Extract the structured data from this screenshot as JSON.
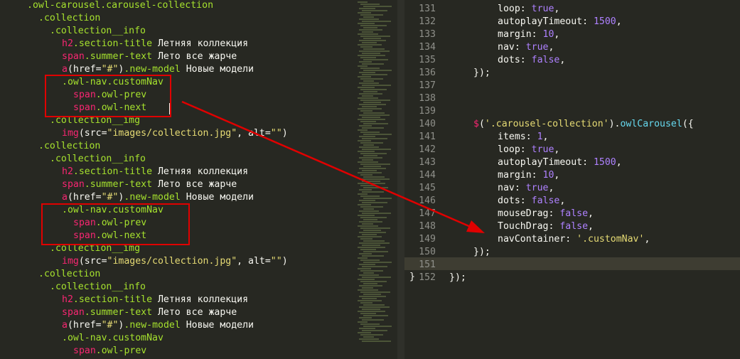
{
  "left_code": [
    [
      {
        "t": ".owl-carousel.carousel-collection",
        "c": "sel"
      }
    ],
    [
      {
        "t": ".collection",
        "c": "sel"
      }
    ],
    [
      {
        "t": ".collection__info",
        "c": "sel"
      }
    ],
    [
      {
        "t": "h2",
        "c": "tag"
      },
      {
        "t": ".section-title",
        "c": "sel"
      },
      {
        "t": " Летняя коллекция",
        "c": "txt"
      }
    ],
    [
      {
        "t": "span",
        "c": "tag"
      },
      {
        "t": ".summer-text",
        "c": "sel"
      },
      {
        "t": " Лето все жарче",
        "c": "txt"
      }
    ],
    [
      {
        "t": "a",
        "c": "tag"
      },
      {
        "t": "(href=",
        "c": "pun"
      },
      {
        "t": "\"#\"",
        "c": "str"
      },
      {
        "t": ")",
        "c": "pun"
      },
      {
        "t": ".new-model",
        "c": "sel"
      },
      {
        "t": " Новые модели",
        "c": "txt"
      }
    ],
    [
      {
        "t": ".owl-nav.customNav",
        "c": "sel"
      }
    ],
    [
      {
        "t": "span",
        "c": "tag"
      },
      {
        "t": ".owl-prev",
        "c": "sel"
      }
    ],
    [
      {
        "t": "span",
        "c": "tag"
      },
      {
        "t": ".owl-next",
        "c": "sel"
      }
    ],
    [
      {
        "t": ".collection__img",
        "c": "sel"
      }
    ],
    [
      {
        "t": "img",
        "c": "tag"
      },
      {
        "t": "(src=",
        "c": "pun"
      },
      {
        "t": "\"images/collection.jpg\"",
        "c": "str"
      },
      {
        "t": ", alt=",
        "c": "pun"
      },
      {
        "t": "\"\"",
        "c": "str"
      },
      {
        "t": ")",
        "c": "pun"
      }
    ],
    [
      {
        "t": ".collection",
        "c": "sel"
      }
    ],
    [
      {
        "t": ".collection__info",
        "c": "sel"
      }
    ],
    [
      {
        "t": "h2",
        "c": "tag"
      },
      {
        "t": ".section-title",
        "c": "sel"
      },
      {
        "t": " Летняя коллекция",
        "c": "txt"
      }
    ],
    [
      {
        "t": "span",
        "c": "tag"
      },
      {
        "t": ".summer-text",
        "c": "sel"
      },
      {
        "t": " Лето все жарче",
        "c": "txt"
      }
    ],
    [
      {
        "t": "a",
        "c": "tag"
      },
      {
        "t": "(href=",
        "c": "pun"
      },
      {
        "t": "\"#\"",
        "c": "str"
      },
      {
        "t": ")",
        "c": "pun"
      },
      {
        "t": ".new-model",
        "c": "sel"
      },
      {
        "t": " Новые модели",
        "c": "txt"
      }
    ],
    [
      {
        "t": ".owl-nav.customNav",
        "c": "sel"
      }
    ],
    [
      {
        "t": "span",
        "c": "tag"
      },
      {
        "t": ".owl-prev",
        "c": "sel"
      }
    ],
    [
      {
        "t": "span",
        "c": "tag"
      },
      {
        "t": ".owl-next",
        "c": "sel"
      }
    ],
    [
      {
        "t": ".collection__img",
        "c": "sel"
      }
    ],
    [
      {
        "t": "img",
        "c": "tag"
      },
      {
        "t": "(src=",
        "c": "pun"
      },
      {
        "t": "\"images/collection.jpg\"",
        "c": "str"
      },
      {
        "t": ", alt=",
        "c": "pun"
      },
      {
        "t": "\"\"",
        "c": "str"
      },
      {
        "t": ")",
        "c": "pun"
      }
    ],
    [
      {
        "t": ".collection",
        "c": "sel"
      }
    ],
    [
      {
        "t": ".collection__info",
        "c": "sel"
      }
    ],
    [
      {
        "t": "h2",
        "c": "tag"
      },
      {
        "t": ".section-title",
        "c": "sel"
      },
      {
        "t": " Летняя коллекция",
        "c": "txt"
      }
    ],
    [
      {
        "t": "span",
        "c": "tag"
      },
      {
        "t": ".summer-text",
        "c": "sel"
      },
      {
        "t": " Лето все жарче",
        "c": "txt"
      }
    ],
    [
      {
        "t": "a",
        "c": "tag"
      },
      {
        "t": "(href=",
        "c": "pun"
      },
      {
        "t": "\"#\"",
        "c": "str"
      },
      {
        "t": ")",
        "c": "pun"
      },
      {
        "t": ".new-model",
        "c": "sel"
      },
      {
        "t": " Новые модели",
        "c": "txt"
      }
    ],
    [
      {
        "t": ".owl-nav.customNav",
        "c": "sel"
      }
    ],
    [
      {
        "t": "span",
        "c": "tag"
      },
      {
        "t": ".owl-prev",
        "c": "sel"
      }
    ]
  ],
  "right_code": [
    {
      "n": "131",
      "s": [
        {
          "t": "loop: ",
          "c": "txt"
        },
        {
          "t": "true",
          "c": "kw"
        },
        {
          "t": ",",
          "c": "txt"
        }
      ]
    },
    {
      "n": "132",
      "s": [
        {
          "t": "autoplayTimeout: ",
          "c": "txt"
        },
        {
          "t": "1500",
          "c": "kw"
        },
        {
          "t": ",",
          "c": "txt"
        }
      ]
    },
    {
      "n": "133",
      "s": [
        {
          "t": "margin: ",
          "c": "txt"
        },
        {
          "t": "10",
          "c": "kw"
        },
        {
          "t": ",",
          "c": "txt"
        }
      ]
    },
    {
      "n": "134",
      "s": [
        {
          "t": "nav: ",
          "c": "txt"
        },
        {
          "t": "true",
          "c": "kw"
        },
        {
          "t": ",",
          "c": "txt"
        }
      ]
    },
    {
      "n": "135",
      "s": [
        {
          "t": "dots: ",
          "c": "txt"
        },
        {
          "t": "false",
          "c": "kw"
        },
        {
          "t": ",",
          "c": "txt"
        }
      ]
    },
    {
      "n": "136",
      "s": [
        {
          "t": "});",
          "c": "txt"
        }
      ]
    },
    {
      "n": "137",
      "s": []
    },
    {
      "n": "138",
      "s": []
    },
    {
      "n": "139",
      "s": []
    },
    {
      "n": "140",
      "s": [
        {
          "t": "$",
          "c": "tag"
        },
        {
          "t": "(",
          "c": "txt"
        },
        {
          "t": "'.carousel-collection'",
          "c": "str"
        },
        {
          "t": ").",
          "c": "txt"
        },
        {
          "t": "owlCarousel",
          "c": "fn"
        },
        {
          "t": "({",
          "c": "txt"
        }
      ]
    },
    {
      "n": "141",
      "s": [
        {
          "t": "items: ",
          "c": "txt"
        },
        {
          "t": "1",
          "c": "kw"
        },
        {
          "t": ",",
          "c": "txt"
        }
      ]
    },
    {
      "n": "142",
      "s": [
        {
          "t": "loop: ",
          "c": "txt"
        },
        {
          "t": "true",
          "c": "kw"
        },
        {
          "t": ",",
          "c": "txt"
        }
      ]
    },
    {
      "n": "143",
      "s": [
        {
          "t": "autoplayTimeout: ",
          "c": "txt"
        },
        {
          "t": "1500",
          "c": "kw"
        },
        {
          "t": ",",
          "c": "txt"
        }
      ]
    },
    {
      "n": "144",
      "s": [
        {
          "t": "margin: ",
          "c": "txt"
        },
        {
          "t": "10",
          "c": "kw"
        },
        {
          "t": ",",
          "c": "txt"
        }
      ]
    },
    {
      "n": "145",
      "s": [
        {
          "t": "nav: ",
          "c": "txt"
        },
        {
          "t": "true",
          "c": "kw"
        },
        {
          "t": ",",
          "c": "txt"
        }
      ]
    },
    {
      "n": "146",
      "s": [
        {
          "t": "dots: ",
          "c": "txt"
        },
        {
          "t": "false",
          "c": "kw"
        },
        {
          "t": ",",
          "c": "txt"
        }
      ]
    },
    {
      "n": "147",
      "s": [
        {
          "t": "mouseDrag: ",
          "c": "txt"
        },
        {
          "t": "false",
          "c": "kw"
        },
        {
          "t": ",",
          "c": "txt"
        }
      ]
    },
    {
      "n": "148",
      "s": [
        {
          "t": "TouchDrag: ",
          "c": "txt"
        },
        {
          "t": "false",
          "c": "kw"
        },
        {
          "t": ",",
          "c": "txt"
        }
      ]
    },
    {
      "n": "149",
      "s": [
        {
          "t": "navContainer: ",
          "c": "txt"
        },
        {
          "t": "'.customNav'",
          "c": "str"
        },
        {
          "t": ",",
          "c": "txt"
        }
      ]
    },
    {
      "n": "150",
      "s": [
        {
          "t": "});",
          "c": "txt"
        }
      ]
    },
    {
      "n": "151",
      "s": []
    },
    {
      "n": "152",
      "s": [
        {
          "t": "});",
          "c": "txt"
        }
      ]
    }
  ],
  "fold_marker": "}",
  "colors": {
    "background": "#272822",
    "annotation": "#e00000",
    "selector": "#a6e22e",
    "tag": "#f92672",
    "string": "#e6db74",
    "constant": "#ae81ff",
    "function": "#66d9ef"
  }
}
